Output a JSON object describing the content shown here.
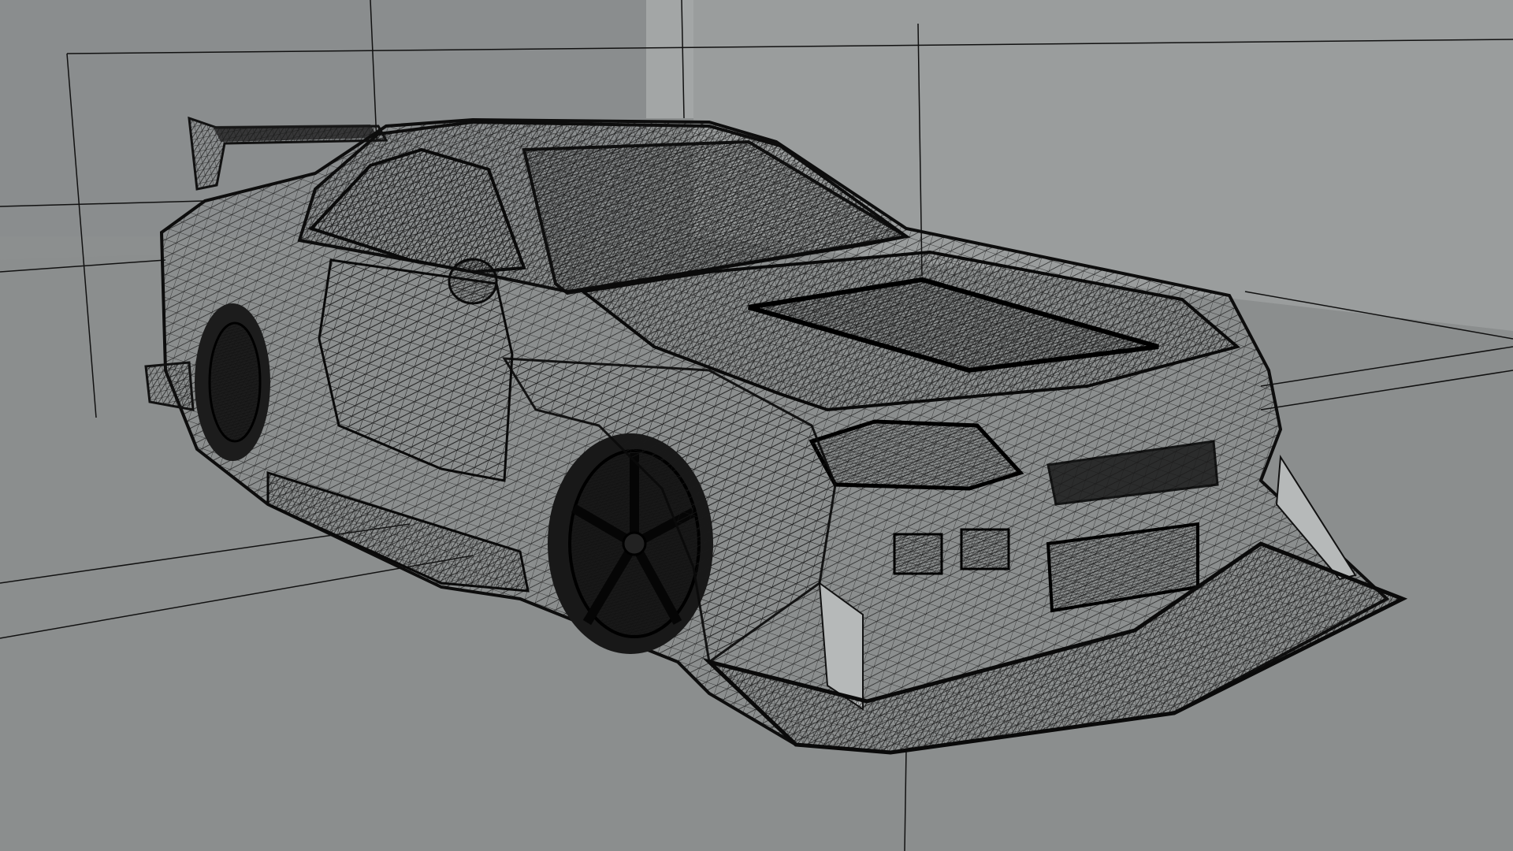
{
  "scene": {
    "type": "3D viewport wireframe render",
    "subject": "car-wireframe",
    "background_color": "#8e9191",
    "wall_color": "#979a9a",
    "floor_color": "#8b8e8e",
    "mesh_line_color": "#111111",
    "text_overlays": []
  }
}
